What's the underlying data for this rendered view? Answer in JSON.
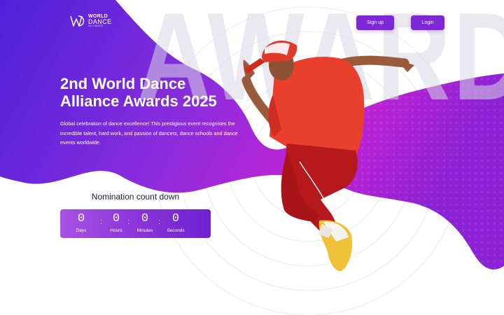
{
  "brand": {
    "line1": "WORLD",
    "line2": "DANCE",
    "line3": "ALLIANCE",
    "monogram": "WD"
  },
  "nav": {
    "signup_label": "Sign up",
    "login_label": "Login"
  },
  "background_word": "AWARDS",
  "hero": {
    "title": "2nd World Dance Alliance Awards 2025",
    "subtitle": "Global celebration of dance excellence! This prestigious event recognises the incredible talent, hard work, and passion of dancers, dance schools and dance events worldwide."
  },
  "countdown": {
    "title": "Nomination count down",
    "units": [
      {
        "value": "0",
        "label": "Days"
      },
      {
        "value": "0",
        "label": "Hours"
      },
      {
        "value": "0",
        "label": "Minutes"
      },
      {
        "value": "0",
        "label": "Seconds"
      }
    ],
    "separator": ":"
  },
  "colors": {
    "purple_dark": "#5a1fd6",
    "purple": "#7e27d8",
    "magenta": "#c21fd0",
    "shirt_red": "#e8402c",
    "cap_red": "#e23a2a",
    "pants_red": "#b5191c",
    "sneaker_yellow": "#f0c23a"
  },
  "icons": {
    "logo": "wda-monogram-icon"
  }
}
